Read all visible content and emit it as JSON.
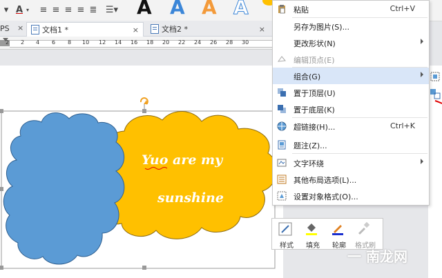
{
  "tabs": [
    {
      "label": "文档1 *"
    },
    {
      "label": "文档2 *"
    }
  ],
  "tabs_prefix": "PS",
  "font_color_letter": "A",
  "style_gallery_letters": [
    "A",
    "A",
    "A",
    "A"
  ],
  "ruler_numbers": [
    "2",
    "2",
    "4",
    "6",
    "8",
    "10",
    "12",
    "14",
    "16",
    "18",
    "20",
    "22",
    "24",
    "26",
    "28",
    "30"
  ],
  "cloud_text": {
    "line1": "Yuo are my",
    "line2": "sunshine"
  },
  "context_menu": {
    "paste": {
      "label": "粘贴",
      "shortcut": "Ctrl+V"
    },
    "save_as_picture": {
      "label": "另存为图片(S)..."
    },
    "change_shape": {
      "label": "更改形状(N)"
    },
    "edit_points": {
      "label": "编辑顶点(E)"
    },
    "group": {
      "label": "组合(G)"
    },
    "bring_to_front": {
      "label": "置于顶层(U)"
    },
    "send_to_back": {
      "label": "置于底层(K)"
    },
    "hyperlink": {
      "label": "超链接(H)...",
      "shortcut": "Ctrl+K"
    },
    "caption": {
      "label": "题注(Z)..."
    },
    "text_wrap": {
      "label": "文字环绕"
    },
    "layout_options": {
      "label": "其他布局选项(L)..."
    },
    "format_object": {
      "label": "设置对象格式(O)..."
    }
  },
  "mini_toolbar": {
    "style": "样式",
    "fill": "填充",
    "outline": "轮廓",
    "format_painter": "格式刷"
  },
  "watermark": "一 南龙网",
  "colors": {
    "blue_cloud": "#5b9bd5",
    "yellow_cloud": "#ffc000",
    "menu_highlight": "#d9e6f8",
    "annotation_red": "#e00000"
  }
}
